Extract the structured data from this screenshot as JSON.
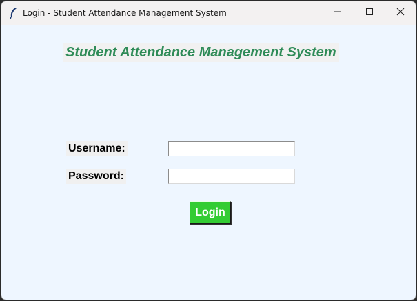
{
  "window": {
    "title": "Login - Student Attendance Management System",
    "controls": {
      "minimize_icon": "minimize-icon",
      "maximize_icon": "maximize-icon",
      "close_icon": "close-icon"
    }
  },
  "form": {
    "heading": "Student Attendance Management System",
    "username_label": "Username:",
    "username_value": "",
    "password_label": "Password:",
    "password_value": "",
    "login_label": "Login"
  },
  "colors": {
    "background": "#eef6ff",
    "heading": "#2e8b57",
    "login_button": "#33cc33"
  }
}
